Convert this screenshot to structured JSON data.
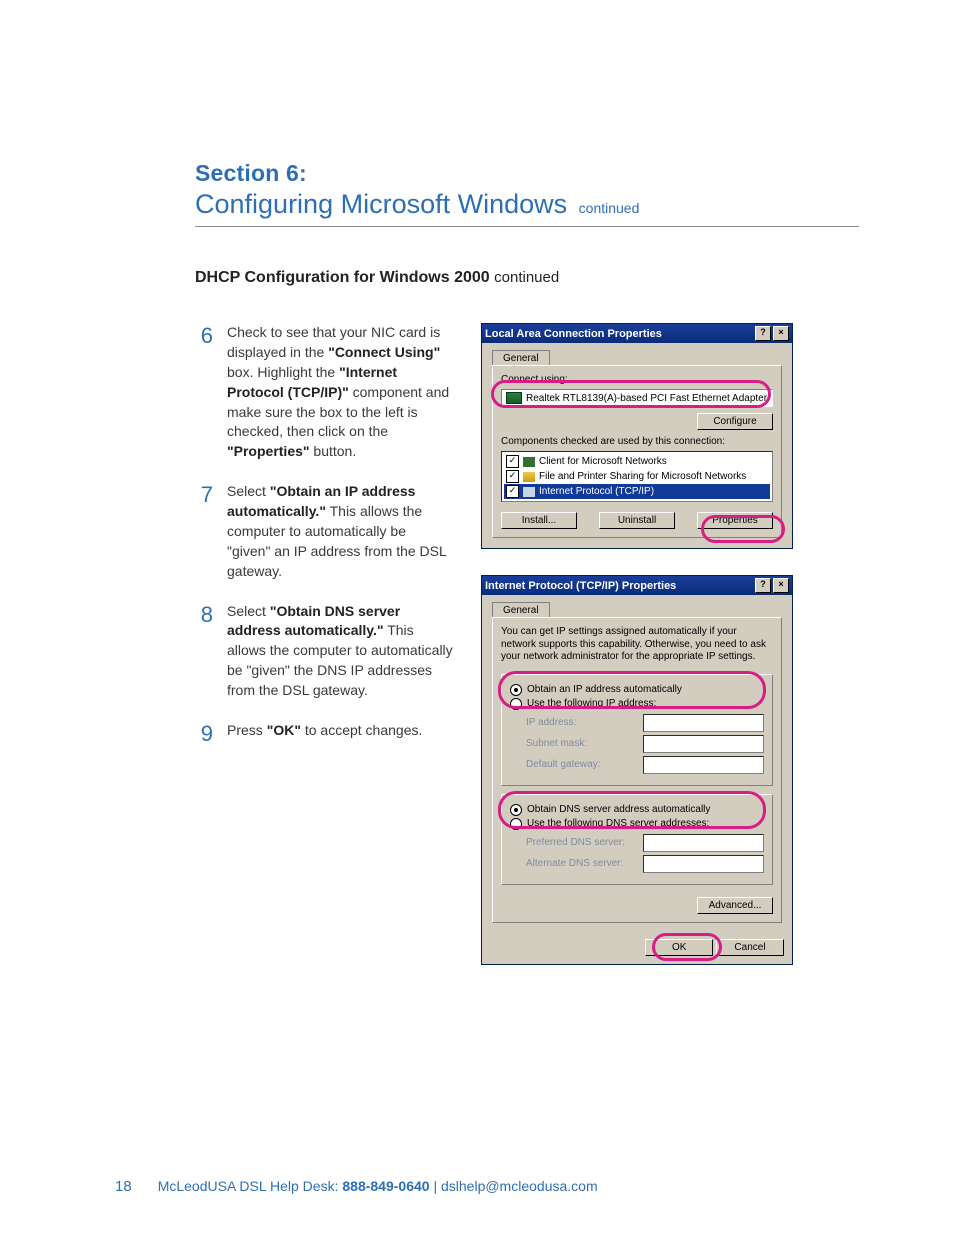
{
  "header": {
    "section_label": "Section 6:",
    "title": "Configuring Microsoft Windows",
    "continued": "continued"
  },
  "subhead": {
    "bold": "DHCP Configuration for Windows 2000",
    "continued": "continued"
  },
  "steps": [
    {
      "num": "6",
      "text_pre": "Check to see that your NIC card is displayed in the ",
      "b1": "\"Connect Using\"",
      "text_mid1": " box. Highlight the ",
      "b2": "\"Internet Protocol (TCP/IP)\"",
      "text_mid2": " component and make sure the box to the left is checked, then click on the ",
      "b3": "\"Properties\"",
      "text_post": " button."
    },
    {
      "num": "7",
      "text_pre": "Select ",
      "b1": "\"Obtain an IP address automatically.\"",
      "text_mid1": " This allows the computer to automatically be \"given\" an IP address from the DSL gateway.",
      "b2": "",
      "text_mid2": "",
      "b3": "",
      "text_post": ""
    },
    {
      "num": "8",
      "text_pre": "Select ",
      "b1": "\"Obtain DNS server address automatically.\"",
      "text_mid1": " This allows the computer to automatically be \"given\" the DNS IP addresses from the DSL gateway.",
      "b2": "",
      "text_mid2": "",
      "b3": "",
      "text_post": ""
    },
    {
      "num": "9",
      "text_pre": "Press ",
      "b1": "\"OK\"",
      "text_mid1": " to accept changes.",
      "b2": "",
      "text_mid2": "",
      "b3": "",
      "text_post": ""
    }
  ],
  "dialog1": {
    "title": "Local Area Connection Properties",
    "help": "?",
    "close": "×",
    "tab_general": "General",
    "connect_using_label": "Connect using:",
    "adapter": "Realtek RTL8139(A)-based PCI Fast Ethernet Adapter",
    "configure_btn": "Configure",
    "components_label": "Components checked are used by this connection:",
    "components": [
      {
        "checked": true,
        "name": "Client for Microsoft Networks",
        "icon": "client"
      },
      {
        "checked": true,
        "name": "File and Printer Sharing for Microsoft Networks",
        "icon": "fp"
      },
      {
        "checked": true,
        "name": "Internet Protocol (TCP/IP)",
        "icon": "tcp",
        "selected": true
      }
    ],
    "install_btn": "Install...",
    "uninstall_btn": "Uninstall",
    "properties_btn": "Properties"
  },
  "dialog2": {
    "title": "Internet Protocol (TCP/IP) Properties",
    "help": "?",
    "close": "×",
    "tab_general": "General",
    "desc": "You can get IP settings assigned automatically if your network supports this capability. Otherwise, you need to ask your network administrator for the appropriate IP settings.",
    "radio_ip_auto": "Obtain an IP address automatically",
    "radio_ip_manual": "Use the following IP address:",
    "ip_address": "IP address:",
    "subnet": "Subnet mask:",
    "gateway": "Default gateway:",
    "radio_dns_auto": "Obtain DNS server address automatically",
    "radio_dns_manual": "Use the following DNS server addresses:",
    "pref_dns": "Preferred DNS server:",
    "alt_dns": "Alternate DNS server:",
    "advanced_btn": "Advanced...",
    "ok_btn": "OK",
    "cancel_btn": "Cancel"
  },
  "footer": {
    "page": "18",
    "brand": "McLeodUSA DSL Help Desk:",
    "phone": "888-849-0640",
    "sep": "|",
    "email": "dslhelp@mcleodusa.com"
  }
}
